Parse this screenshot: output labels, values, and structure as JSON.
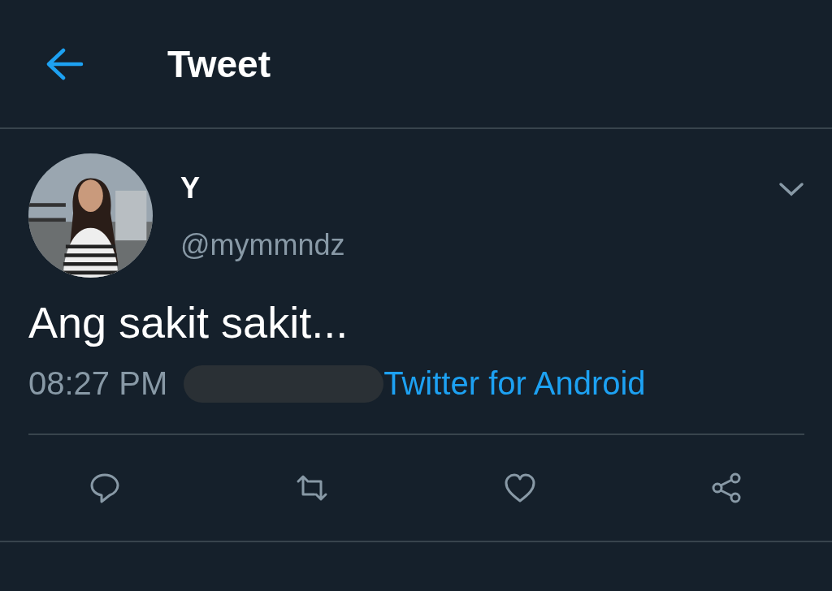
{
  "header": {
    "title": "Tweet"
  },
  "tweet": {
    "name": "Y",
    "handle": "@mymmndz",
    "text": "Ang sakit sakit...",
    "time": "08:27 PM",
    "date_redacted": true,
    "source": "Twitter for Android"
  },
  "actions": [
    {
      "kind": "reply"
    },
    {
      "kind": "retweet"
    },
    {
      "kind": "like"
    },
    {
      "kind": "share"
    }
  ]
}
